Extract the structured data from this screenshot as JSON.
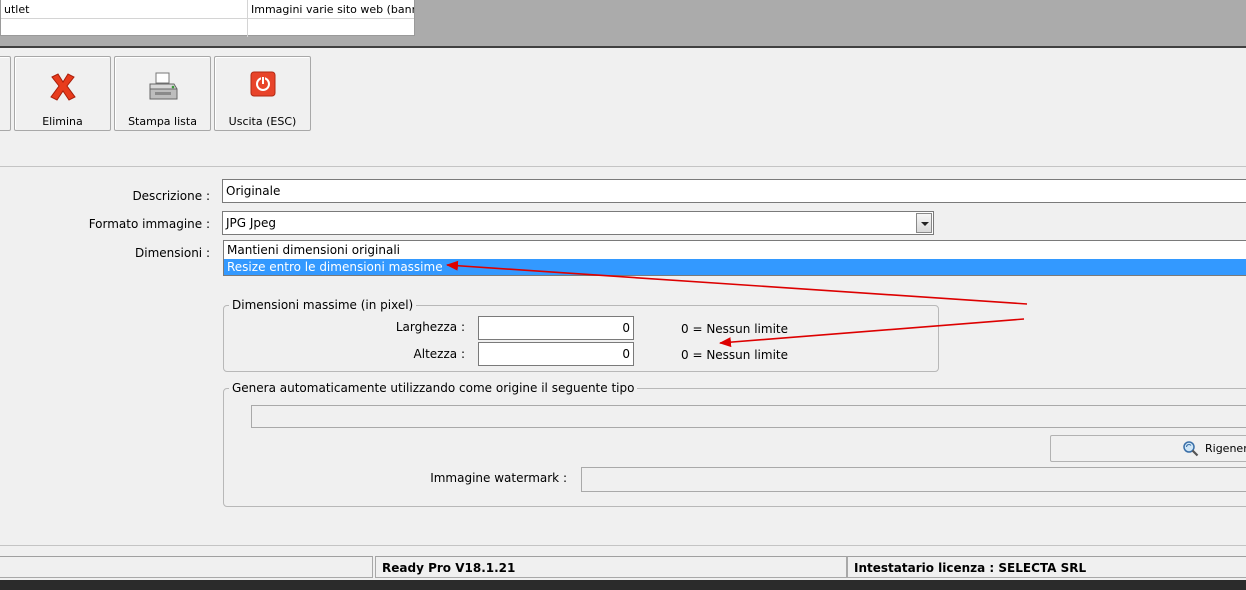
{
  "top_grid": {
    "rows": [
      {
        "col1": "utlet",
        "col2": "Immagini varie sito web (banne..."
      },
      {
        "col1": "",
        "col2": ""
      }
    ]
  },
  "toolbar": {
    "elimina_label": "Elimina",
    "stampa_label": "Stampa lista",
    "uscita_label": "Uscita (ESC)"
  },
  "form": {
    "descrizione_label": "Descrizione :",
    "descrizione_value": "Originale",
    "formato_label": "Formato immagine :",
    "formato_value": "JPG Jpeg",
    "dimensioni_label": "Dimensioni :",
    "dimensioni_options": [
      "Mantieni dimensioni originali",
      "Resize entro le dimensioni massime"
    ],
    "dimensioni_selected": 1
  },
  "max_dims": {
    "title": "Dimensioni massime (in pixel)",
    "larghezza_label": "Larghezza :",
    "larghezza_value": "0",
    "altezza_label": "Altezza :",
    "altezza_value": "0",
    "note_larghezza": "0 =  Nessun limite",
    "note_altezza": "0 =  Nessun limite"
  },
  "auto_gen": {
    "title": "Genera automaticamente utilizzando come origine il seguente tipo",
    "source_value": "",
    "rigenera_label": "Rigenera",
    "watermark_label": "Immagine watermark :",
    "watermark_value": ""
  },
  "status": {
    "left": "",
    "version": "Ready Pro V18.1.21",
    "license": "Intestatario licenza : SELECTA SRL"
  },
  "colors": {
    "selection": "#3399ff",
    "annotation_arrow": "#dd0000",
    "exit_icon": "#e8442a"
  },
  "icons": [
    "delete-x-icon",
    "printer-icon",
    "power-exit-icon",
    "regenerate-icon",
    "dropdown-arrow-icon"
  ]
}
